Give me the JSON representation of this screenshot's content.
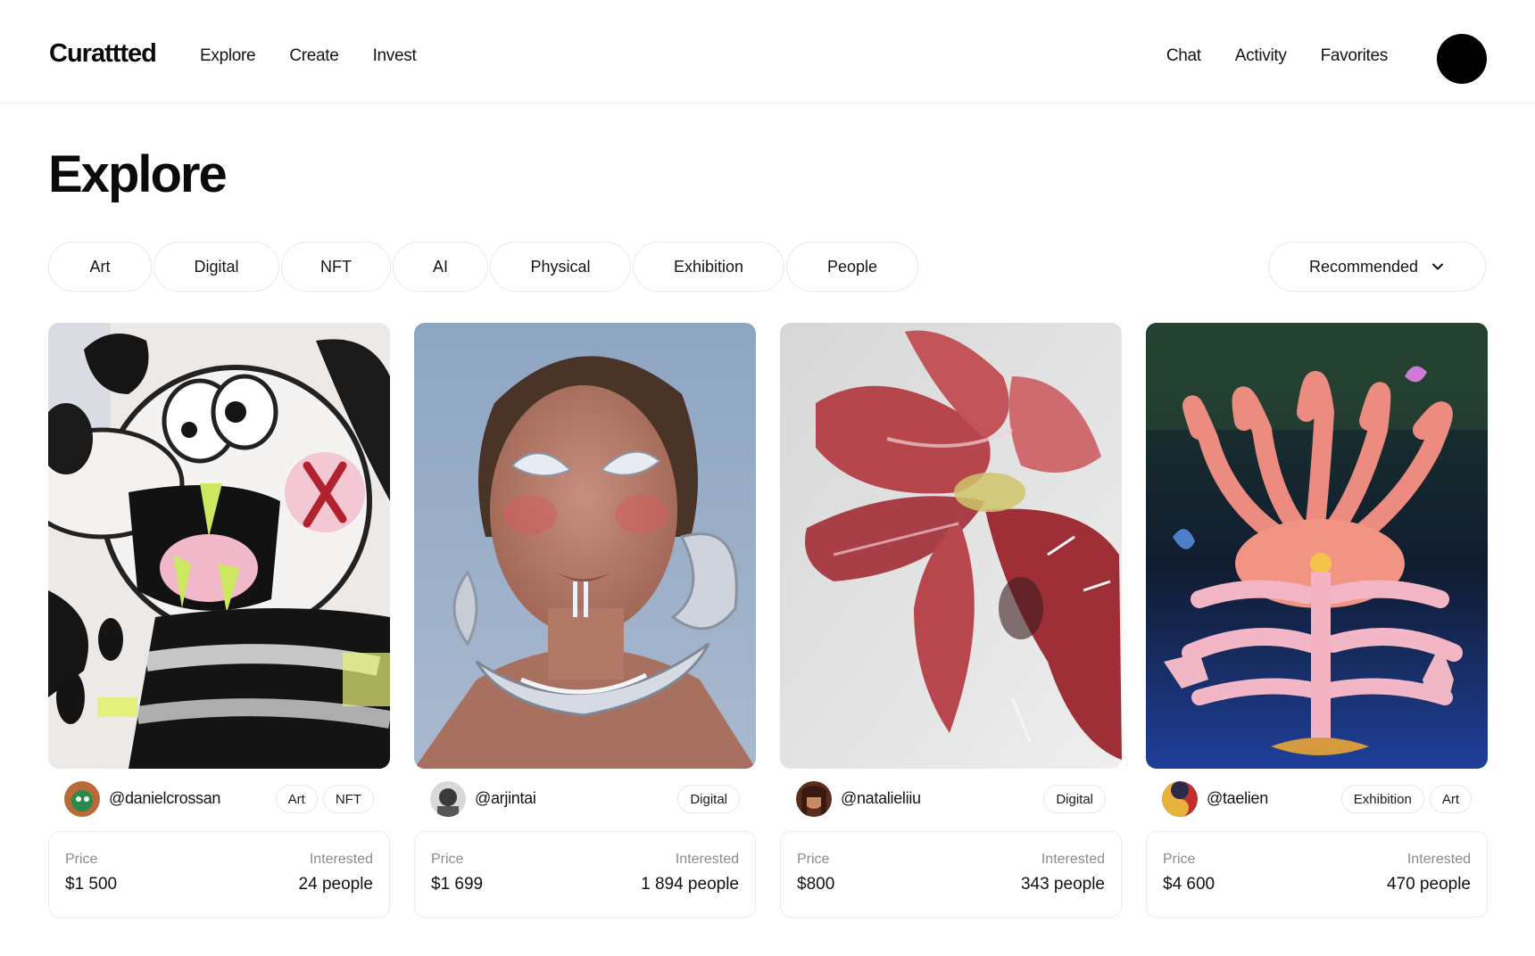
{
  "header": {
    "logo": "Curattted",
    "nav_left": [
      "Explore",
      "Create",
      "Invest"
    ],
    "nav_right": [
      "Chat",
      "Activity",
      "Favorites"
    ]
  },
  "page": {
    "title": "Explore"
  },
  "filters": [
    "Art",
    "Digital",
    "NFT",
    "AI",
    "Physical",
    "Exhibition",
    "People"
  ],
  "sort": {
    "label": "Recommended"
  },
  "cards": [
    {
      "username": "@danielcrossan",
      "tags": [
        "Art",
        "NFT"
      ],
      "price_label": "Price",
      "price": "$1 500",
      "interested_label": "Interested",
      "interested": "24 people"
    },
    {
      "username": "@arjintai",
      "tags": [
        "Digital"
      ],
      "price_label": "Price",
      "price": "$1 699",
      "interested_label": "Interested",
      "interested": "1 894 people"
    },
    {
      "username": "@natalieliiu",
      "tags": [
        "Digital"
      ],
      "price_label": "Price",
      "price": "$800",
      "interested_label": "Interested",
      "interested": "343 people"
    },
    {
      "username": "@taelien",
      "tags": [
        "Exhibition",
        "Art"
      ],
      "price_label": "Price",
      "price": "$4 600",
      "interested_label": "Interested",
      "interested": "470 people"
    }
  ]
}
